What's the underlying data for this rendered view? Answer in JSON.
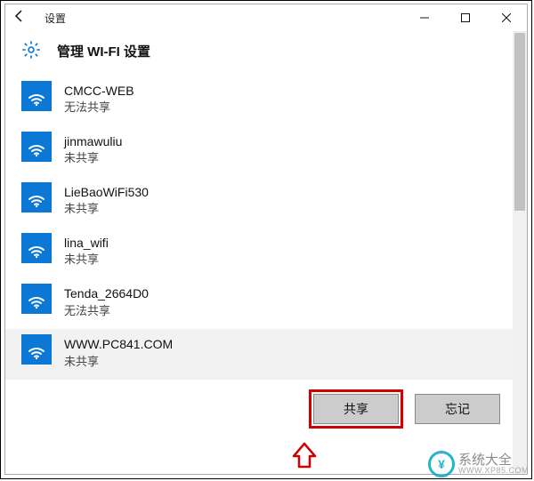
{
  "titlebar": {
    "title": "设置"
  },
  "header": {
    "title": "管理 WI-FI 设置"
  },
  "networks": [
    {
      "ssid": "CMCC-WEB",
      "status": "无法共享",
      "selected": false
    },
    {
      "ssid": "jinmawuliu",
      "status": "未共享",
      "selected": false
    },
    {
      "ssid": "LieBaoWiFi530",
      "status": "未共享",
      "selected": false
    },
    {
      "ssid": "lina_wifi",
      "status": "未共享",
      "selected": false
    },
    {
      "ssid": "Tenda_2664D0",
      "status": "无法共享",
      "selected": false
    },
    {
      "ssid": "WWW.PC841.COM",
      "status": "未共享",
      "selected": true
    }
  ],
  "buttons": {
    "share": "共享",
    "forget": "忘记"
  },
  "watermark": {
    "main": "系统大全",
    "sub": "WWW.XP85.COM"
  }
}
